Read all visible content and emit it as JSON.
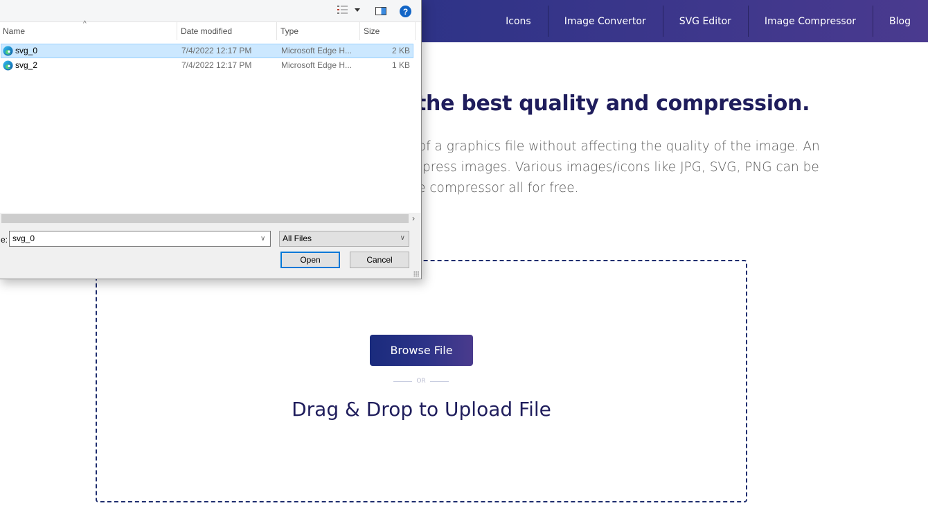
{
  "nav": {
    "items": [
      "Icons",
      "Image Convertor",
      "SVG Editor",
      "Image Compressor",
      "Blog"
    ]
  },
  "hero": {
    "title": "the best quality and compression.",
    "desc_lines": [
      ", of a graphics file without affecting the quality of the image. An",
      "mpress images. Various images/icons like JPG, SVG, PNG can be",
      "ge compressor all for free."
    ]
  },
  "upload": {
    "browse_label": "Browse File",
    "or_label": "OR",
    "drag_label": "Drag & Drop to Upload File"
  },
  "dialog": {
    "columns": {
      "name": "Name",
      "date": "Date modified",
      "type": "Type",
      "size": "Size"
    },
    "files": [
      {
        "name": "svg_0",
        "date": "7/4/2022 12:17 PM",
        "type": "Microsoft Edge H...",
        "size": "2 KB",
        "selected": true
      },
      {
        "name": "svg_2",
        "date": "7/4/2022 12:17 PM",
        "type": "Microsoft Edge H...",
        "size": "1 KB",
        "selected": false
      }
    ],
    "filename_label": "e:",
    "filename_value": "svg_0",
    "filter_value": "All Files",
    "open_label": "Open",
    "cancel_label": "Cancel",
    "help_glyph": "?"
  },
  "colors": {
    "brand_navy": "#1f1d5c",
    "gradient_start": "#1a2b7d",
    "gradient_end": "#4a3b8d",
    "selection": "#cce8ff",
    "focus_blue": "#0078d7"
  }
}
